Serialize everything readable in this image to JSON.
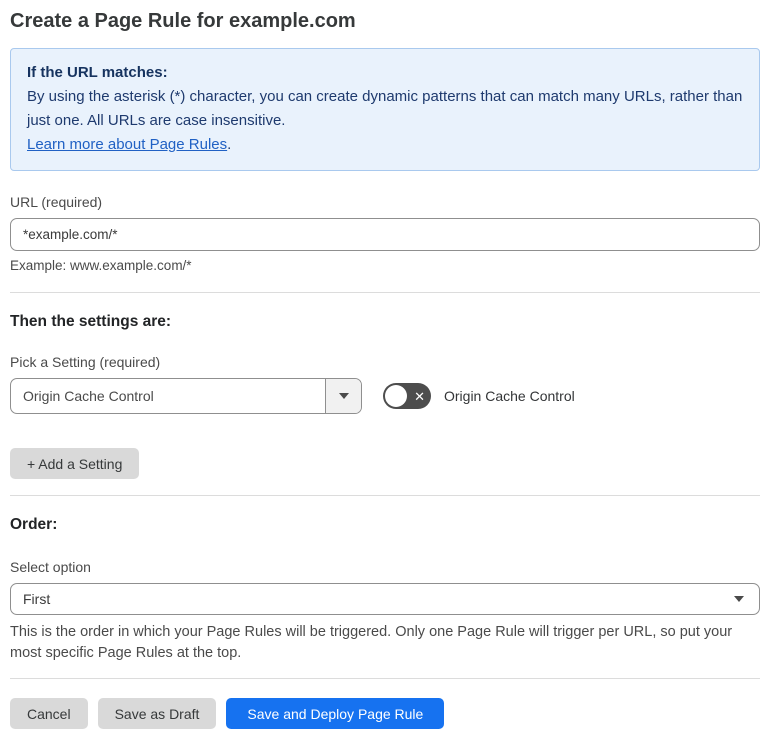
{
  "page": {
    "title": "Create a Page Rule for example.com"
  },
  "info_box": {
    "heading": "If the URL matches:",
    "body": "By using the asterisk (*) character, you can create dynamic patterns that can match many URLs, rather than just one. All URLs are case insensitive.",
    "link": "Learn more about Page Rules",
    "link_suffix": "."
  },
  "url_field": {
    "label": "URL (required)",
    "value": "*example.com/*",
    "example": "Example: www.example.com/*"
  },
  "settings_section": {
    "heading": "Then the settings are:",
    "picker_label": "Pick a Setting (required)",
    "picker_value": "Origin Cache Control",
    "toggle_state": "off",
    "toggle_icon": "✕",
    "toggle_label": "Origin Cache Control",
    "add_button": "+ Add a Setting"
  },
  "order_section": {
    "heading": "Order:",
    "select_label": "Select option",
    "select_value": "First",
    "help": "This is the order in which your Page Rules will be triggered. Only one Page Rule will trigger per URL, so put your most specific Page Rules at the top."
  },
  "actions": {
    "cancel": "Cancel",
    "save_draft": "Save as Draft",
    "save_deploy": "Save and Deploy Page Rule"
  },
  "colors": {
    "info_bg": "#e9f2fc",
    "info_border": "#a9c9ee",
    "info_text": "#1e3a6e",
    "link_blue": "#2061c4",
    "primary_blue": "#1672f0",
    "gray_button": "#d9d9d9",
    "toggle_off": "#4d4d4d",
    "input_border": "#8f8f8f",
    "divider": "#dcdcdc"
  }
}
